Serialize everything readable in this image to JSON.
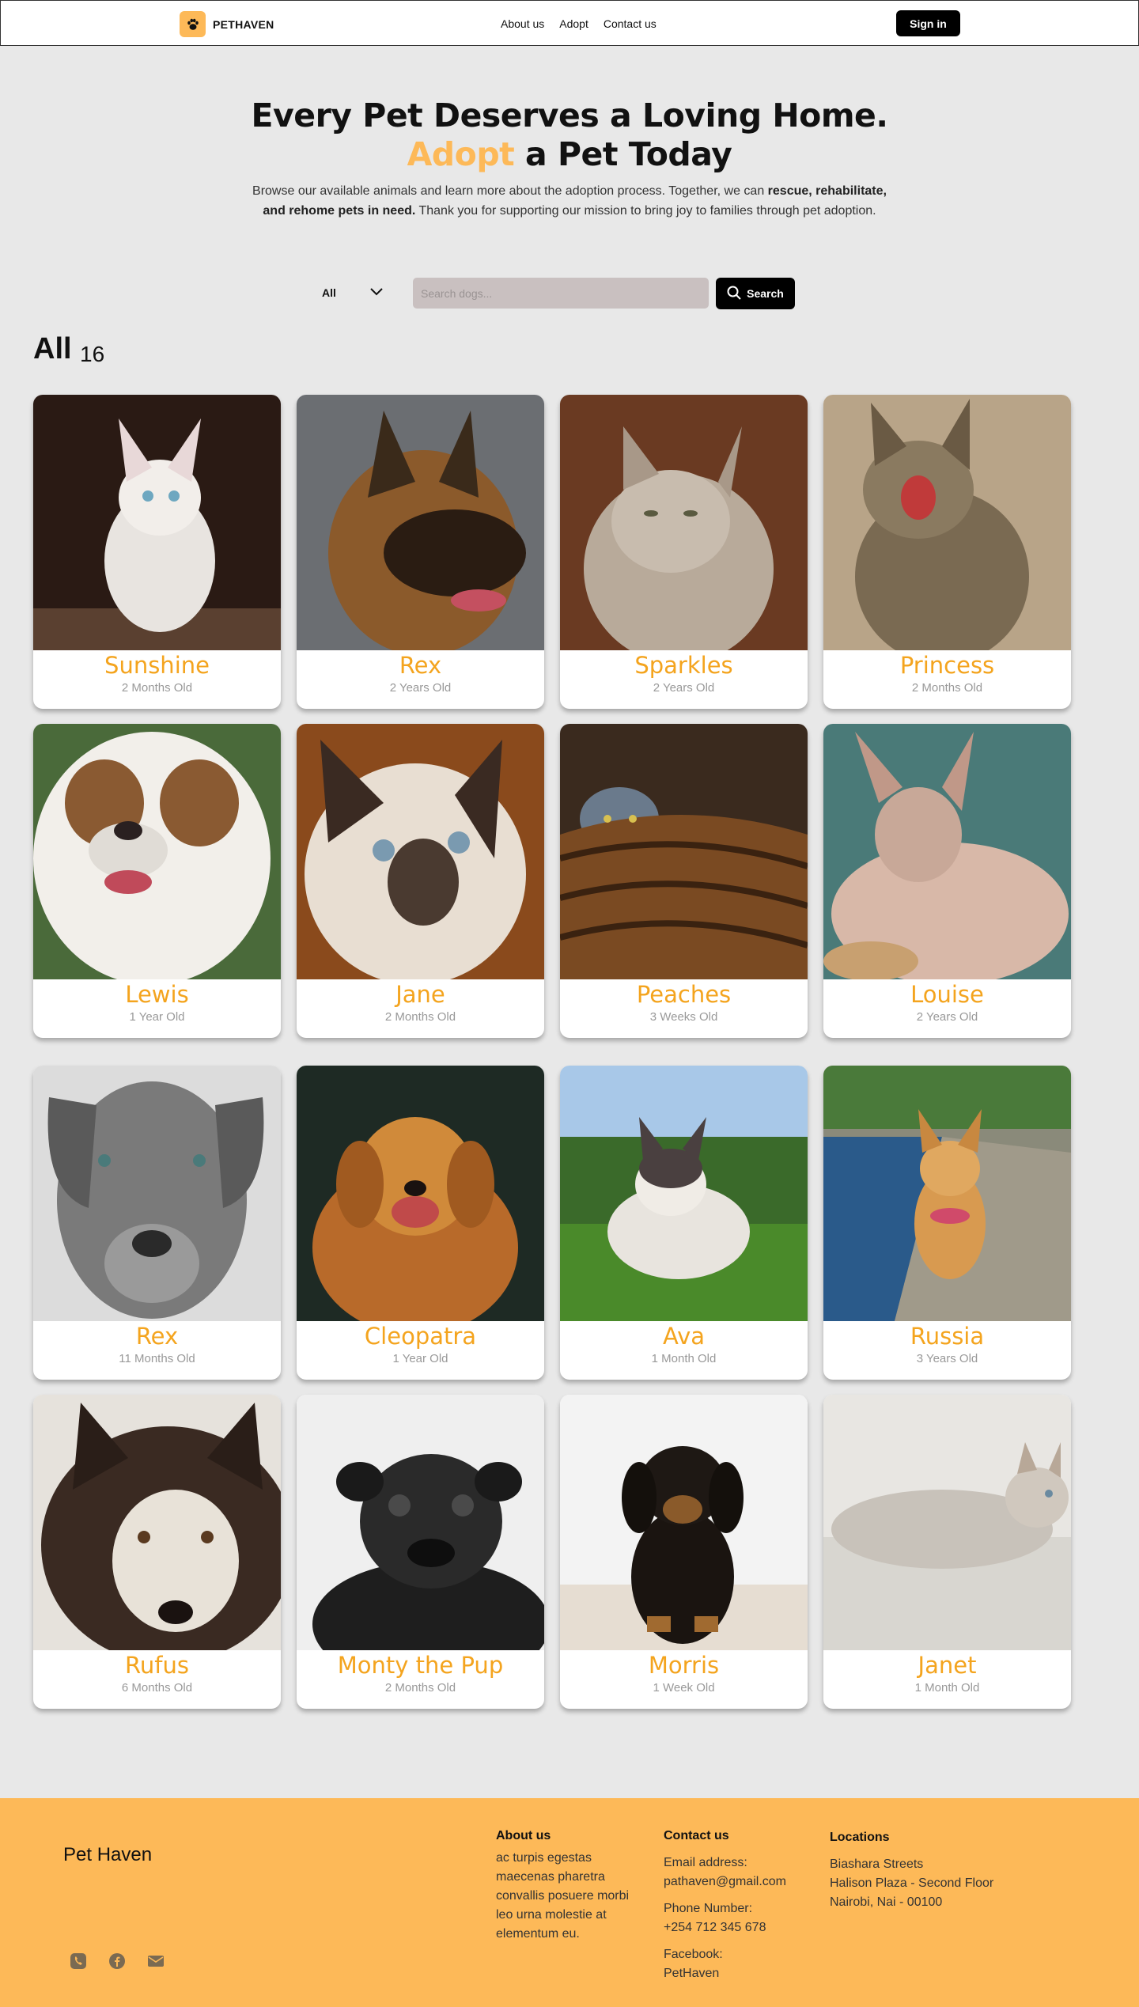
{
  "nav": {
    "brand": "PETHAVEN",
    "links": [
      "About us",
      "Adopt",
      "Contact us"
    ],
    "signin": "Sign in"
  },
  "hero": {
    "title_line1": "Every Pet Deserves a Loving Home.",
    "title_accent": "Adopt",
    "title_line2_rest": " a Pet Today",
    "desc_part1": "Browse our available animals and learn more about the adoption process. Together, we can ",
    "desc_bold": "rescue, rehabilitate, and rehome pets in need.",
    "desc_part2": " Thank you for supporting our mission to bring joy to families through pet adoption."
  },
  "filter": {
    "selected": "All",
    "search_placeholder": "Search dogs...",
    "search_button": "Search"
  },
  "section": {
    "title": "All",
    "count": "16"
  },
  "pets": [
    {
      "name": "Sunshine",
      "age": "2 Months Old"
    },
    {
      "name": "Rex",
      "age": "2 Years Old"
    },
    {
      "name": "Sparkles",
      "age": "2 Years Old"
    },
    {
      "name": "Princess",
      "age": "2 Months Old"
    },
    {
      "name": "Lewis",
      "age": "1 Year Old"
    },
    {
      "name": "Jane",
      "age": "2 Months Old"
    },
    {
      "name": "Peaches",
      "age": "3 Weeks Old"
    },
    {
      "name": "Louise",
      "age": "2 Years Old"
    },
    {
      "name": "Rex",
      "age": "11 Months Old"
    },
    {
      "name": "Cleopatra",
      "age": "1 Year Old"
    },
    {
      "name": "Ava",
      "age": "1 Month Old"
    },
    {
      "name": "Russia",
      "age": "3 Years Old"
    },
    {
      "name": "Rufus",
      "age": "6 Months Old"
    },
    {
      "name": "Monty the Pup",
      "age": "2 Months Old"
    },
    {
      "name": "Morris",
      "age": "1 Week Old"
    },
    {
      "name": "Janet",
      "age": "1 Month Old"
    }
  ],
  "footer": {
    "brand": "Pet Haven",
    "about_title": "About us",
    "about_text": "ac  turpis egestas maecenas pharetra convallis posuere morbi leo urna  molestie at elementum eu.",
    "contact_title": "Contact us",
    "email_label": "Email address:",
    "email": "pathaven@gmail.com",
    "phone_label": "Phone Number:",
    "phone": "+254 712 345 678",
    "facebook_label": "Facebook:",
    "facebook": "PetHaven",
    "locations_title": "Locations",
    "loc1": "Biashara Streets",
    "loc2": "Halison Plaza - Second Floor",
    "loc3": "Nairobi, Nai - 00100",
    "icons": [
      "phone-icon",
      "facebook-icon",
      "mail-icon"
    ]
  },
  "colors": {
    "accent": "#fdb958",
    "pet_name": "#f4a41e",
    "button": "#000000"
  }
}
